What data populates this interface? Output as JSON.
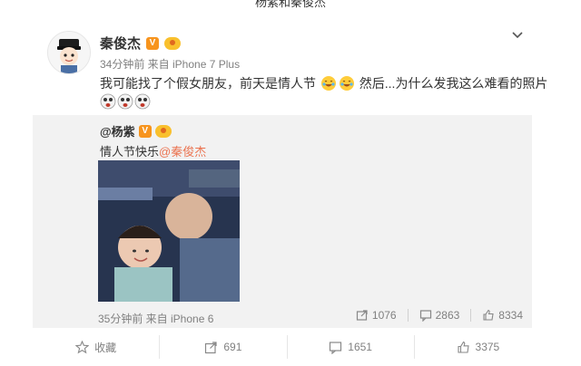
{
  "page": {
    "top_cut_text": "杨紫和秦俊杰"
  },
  "post": {
    "author": "秦俊杰",
    "meta": "34分钟前 来自 iPhone 7 Plus",
    "text_part1": "我可能找了个假女朋友，前天是情人节",
    "text_part2": "然后...为什么发我这么难看的照片",
    "menu_icon": "chevron-down-icon"
  },
  "repost": {
    "author": "@杨紫",
    "text": "情人节快乐",
    "mention": "@秦俊杰",
    "meta": "35分钟前 来自 iPhone 6",
    "actions": {
      "repost_count": "1076",
      "comment_count": "2863",
      "like_count": "8334"
    }
  },
  "footer": {
    "favorite_label": "收藏",
    "repost_count": "691",
    "comment_count": "1651",
    "like_count": "3375"
  },
  "colors": {
    "mention": "#eb7350",
    "verified_badge": "#f7941d",
    "meta_text": "#808080",
    "repost_bg": "#f2f2f2"
  }
}
